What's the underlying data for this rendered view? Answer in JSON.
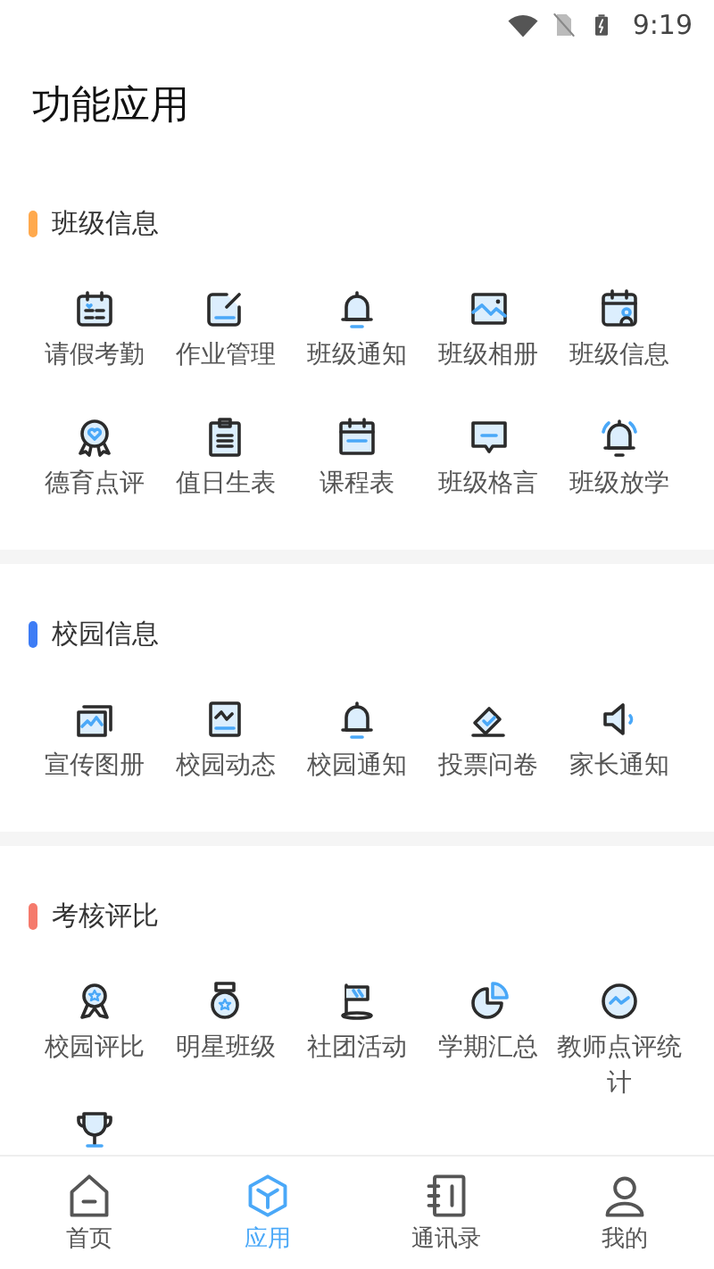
{
  "status_bar": {
    "time": "9:19"
  },
  "page_title": "功能应用",
  "sections": [
    {
      "title": "班级信息",
      "color": "#ffa94d",
      "items": [
        {
          "kind": "labeled",
          "label": "请假考勤"
        },
        {
          "kind": "labeled",
          "label": "作业管理"
        },
        {
          "kind": "labeled",
          "label": "班级通知"
        },
        {
          "kind": "labeled",
          "label": "班级相册"
        },
        {
          "kind": "labeled",
          "label": "班级信息"
        },
        {
          "kind": "labeled",
          "label": "德育点评"
        },
        {
          "kind": "labeled",
          "label": "值日生表"
        },
        {
          "kind": "labeled",
          "label": "课程表"
        },
        {
          "kind": "labeled",
          "label": "班级格言"
        },
        {
          "kind": "labeled",
          "label": "班级放学"
        }
      ]
    },
    {
      "title": "校园信息",
      "color": "#3d7cf5",
      "items": [
        {
          "kind": "labeled",
          "label": "宣传图册"
        },
        {
          "kind": "labeled",
          "label": "校园动态"
        },
        {
          "kind": "labeled",
          "label": "校园通知"
        },
        {
          "kind": "labeled",
          "label": "投票问卷"
        },
        {
          "kind": "labeled",
          "label": "家长通知"
        }
      ]
    },
    {
      "title": "考核评比",
      "color": "#f57a6c",
      "items": [
        {
          "kind": "labeled",
          "label": "校园评比"
        },
        {
          "kind": "labeled",
          "label": "明星班级"
        },
        {
          "kind": "labeled",
          "label": "社团活动"
        },
        {
          "kind": "labeled",
          "label": "学期汇总"
        },
        {
          "kind": "labeled",
          "label": "教师点评统计"
        },
        {
          "kind": "icon-only"
        }
      ]
    }
  ],
  "tab_bar": [
    {
      "label": "首页",
      "selected": false
    },
    {
      "label": "应用",
      "selected": true
    },
    {
      "label": "通讯录",
      "selected": false
    },
    {
      "label": "我的",
      "selected": false
    }
  ]
}
